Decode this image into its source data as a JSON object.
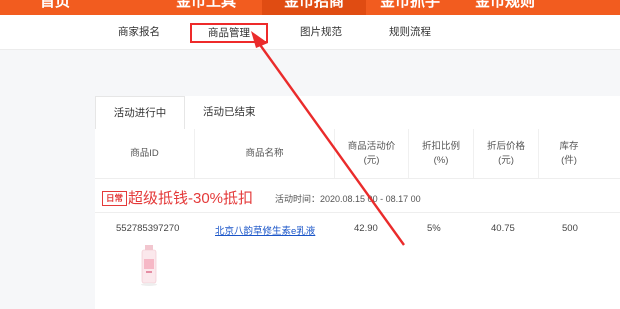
{
  "top_nav": {
    "items": [
      "首页",
      "金币工具",
      "金币招商",
      "金币抓手",
      "金币规则"
    ]
  },
  "sub_nav": {
    "items": [
      "商家报名",
      "商品管理",
      "图片规范",
      "规则流程"
    ],
    "active_index": 1
  },
  "tabs": [
    "活动进行中",
    "活动已结束"
  ],
  "table": {
    "columns": [
      {
        "label": "商品ID"
      },
      {
        "label": "商品名称"
      },
      {
        "label": "商品活动价",
        "unit": "(元)"
      },
      {
        "label": "折扣比例",
        "unit": "(%)"
      },
      {
        "label": "折后价格",
        "unit": "(元)"
      },
      {
        "label": "库存",
        "unit": "(件)"
      }
    ]
  },
  "promotion": {
    "tag": "日常",
    "title": "超级抵钱-30%抵扣",
    "time_label": "活动时间：",
    "time_range": "2020.08.15 00 - 08.17 00"
  },
  "product": {
    "id": "552785397270",
    "name": "北京八韵草修生素e乳液",
    "activity_price": "42.90",
    "discount": "5%",
    "final_price": "40.75",
    "stock": "500"
  },
  "colors": {
    "brand_orange": "#f25c1f",
    "highlight_red": "#ee2a2a",
    "link_blue": "#1a55c8"
  }
}
